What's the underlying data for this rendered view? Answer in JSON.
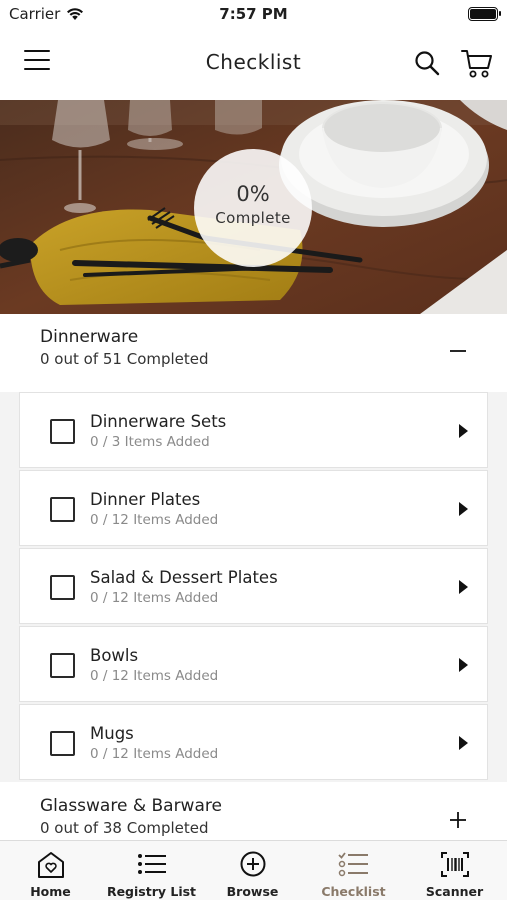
{
  "status_bar": {
    "carrier": "Carrier",
    "time": "7:57 PM"
  },
  "nav": {
    "title": "Checklist",
    "icons": [
      "menu-icon",
      "search-icon",
      "cart-icon"
    ]
  },
  "hero": {
    "progress_percent": "0%",
    "progress_label": "Complete",
    "progress_value": 0
  },
  "categories": [
    {
      "name": "Dinnerware",
      "status": "0 out of 51 Completed",
      "expanded": true,
      "toggle_icon": "minus-icon",
      "items": [
        {
          "name": "Dinnerware Sets",
          "count": "0 / 3 Items Added",
          "checked": false
        },
        {
          "name": "Dinner Plates",
          "count": "0 / 12 Items Added",
          "checked": false
        },
        {
          "name": "Salad & Dessert Plates",
          "count": "0 / 12 Items Added",
          "checked": false
        },
        {
          "name": "Bowls",
          "count": "0 / 12 Items Added",
          "checked": false
        },
        {
          "name": "Mugs",
          "count": "0 / 12 Items Added",
          "checked": false
        }
      ]
    },
    {
      "name": "Glassware & Barware",
      "status": "0 out of 38 Completed",
      "expanded": false,
      "toggle_icon": "plus-icon"
    }
  ],
  "tabs": [
    {
      "label": "Home",
      "icon": "home-icon",
      "active": false
    },
    {
      "label": "Registry List",
      "icon": "list-icon",
      "active": false
    },
    {
      "label": "Browse",
      "icon": "plus-circle-icon",
      "active": false
    },
    {
      "label": "Checklist",
      "icon": "checklist-icon",
      "active": true
    },
    {
      "label": "Scanner",
      "icon": "barcode-scanner-icon",
      "active": false
    }
  ],
  "colors": {
    "active_tab": "#8a7a6a",
    "text": "#222222",
    "muted_text": "#8a8a8a",
    "panel_background": "#f3f3f3"
  }
}
